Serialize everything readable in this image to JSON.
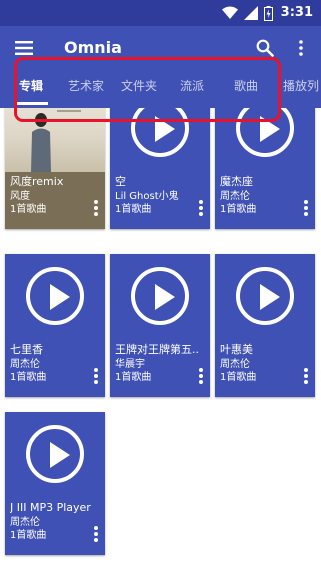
{
  "status_bar": {
    "time": "3:31",
    "icons": [
      "wifi-icon",
      "signal-icon",
      "battery-icon"
    ]
  },
  "app_bar": {
    "title": "Omnia",
    "icons": [
      "menu-icon",
      "search-icon",
      "more-vert-icon"
    ]
  },
  "tabs": [
    {
      "label": "专辑",
      "active": true
    },
    {
      "label": "艺术家",
      "active": false
    },
    {
      "label": "文件夹",
      "active": false
    },
    {
      "label": "流派",
      "active": false
    },
    {
      "label": "歌曲",
      "active": false
    },
    {
      "label": "播放列",
      "active": false
    }
  ],
  "albums": [
    {
      "title": "风度remix",
      "artist": "风度",
      "count": "1首歌曲",
      "art": "photo"
    },
    {
      "title": "空",
      "artist": "Lil Ghost小鬼",
      "count": "1首歌曲",
      "art": "play-icon"
    },
    {
      "title": "魔杰座",
      "artist": "周杰伦",
      "count": "1首歌曲",
      "art": "play-icon"
    },
    {
      "title": "七里香",
      "artist": "周杰伦",
      "count": "1首歌曲",
      "art": "play-icon"
    },
    {
      "title": "王牌对王牌第五...",
      "artist": "华晨宇",
      "count": "1首歌曲",
      "art": "play-icon"
    },
    {
      "title": "叶惠美",
      "artist": "周杰伦",
      "count": "1首歌曲",
      "art": "play-icon"
    },
    {
      "title": "J III MP3 Player",
      "artist": "周杰伦",
      "count": "1首歌曲",
      "art": "play-icon"
    }
  ],
  "colors": {
    "primary": "#3f51b5",
    "status_bar": "#2f3c9c",
    "highlight": "#e8132b"
  }
}
